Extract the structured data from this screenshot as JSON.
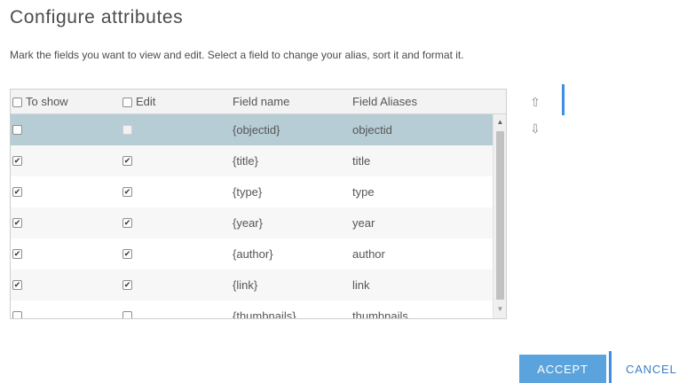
{
  "dialog": {
    "title": "Configure  attributes",
    "description": "Mark the fields you want to view and edit. Select a field to change your alias, sort it and format it."
  },
  "table": {
    "headers": {
      "to_show": "To show",
      "edit": "Edit",
      "field_name": "Field name",
      "field_aliases": "Field Aliases"
    },
    "rows": [
      {
        "field_name": "{objectid}",
        "alias": "objectid",
        "show": false,
        "edit": false,
        "edit_disabled": true,
        "selected": true
      },
      {
        "field_name": "{title}",
        "alias": "title",
        "show": true,
        "edit": true,
        "edit_disabled": false,
        "selected": false
      },
      {
        "field_name": "{type}",
        "alias": "type",
        "show": true,
        "edit": true,
        "edit_disabled": false,
        "selected": false
      },
      {
        "field_name": "{year}",
        "alias": "year",
        "show": true,
        "edit": true,
        "edit_disabled": false,
        "selected": false
      },
      {
        "field_name": "{author}",
        "alias": "author",
        "show": true,
        "edit": true,
        "edit_disabled": false,
        "selected": false
      },
      {
        "field_name": "{link}",
        "alias": "link",
        "show": true,
        "edit": true,
        "edit_disabled": false,
        "selected": false
      },
      {
        "field_name": "{thumbnails}",
        "alias": "thumbnails",
        "show": false,
        "edit": false,
        "edit_disabled": false,
        "selected": false
      }
    ]
  },
  "icons": {
    "move_up": "arrow-up-icon",
    "move_down": "arrow-down-icon",
    "scroll_up": "scroll-up-icon",
    "scroll_down": "scroll-down-icon"
  },
  "colors": {
    "accent": "#5aa3dd",
    "focus": "#3d8fe0",
    "selected_row": "#b7cdd6",
    "cancel_text": "#3b7fc4"
  },
  "buttons": {
    "accept": "ACCEPT",
    "cancel": "CANCEL"
  }
}
